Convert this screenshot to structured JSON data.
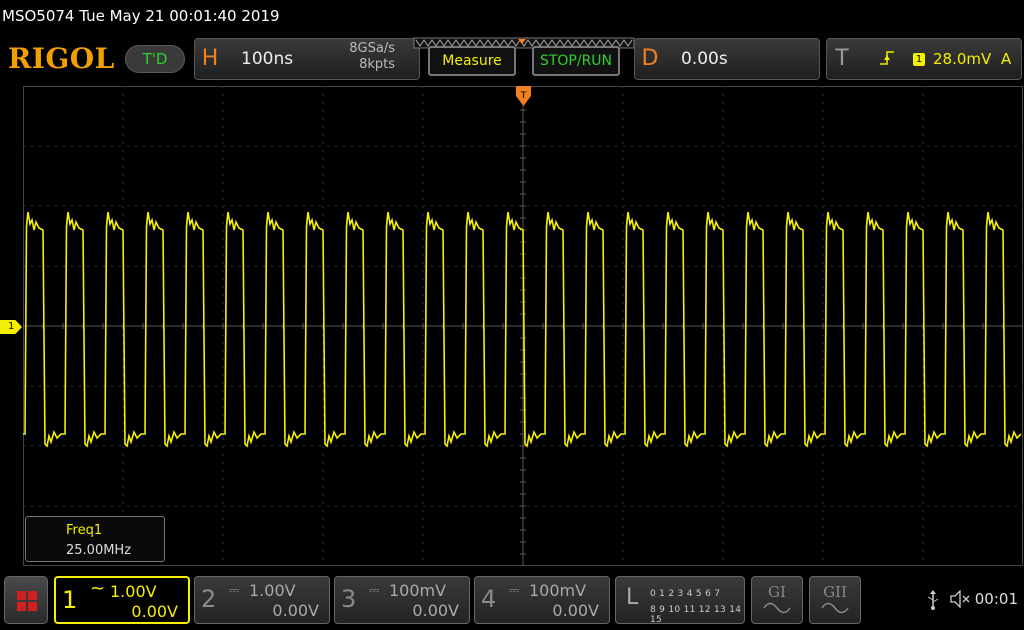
{
  "title": "MSO5074  Tue May 21 00:01:40 2019",
  "logo": "RIGOL",
  "trigger_status_badge": "T'D",
  "horizontal": {
    "letter": "H",
    "timebase": "100ns",
    "sample_rate": "8GSa/s",
    "memory_depth": "8kpts"
  },
  "buttons": {
    "measure": "Measure",
    "stop_run": "STOP/RUN"
  },
  "delay": {
    "letter": "D",
    "value": "0.00s"
  },
  "trigger": {
    "letter": "T",
    "channel": "1",
    "level": "28.0mV",
    "mode": "A"
  },
  "channel1_marker": "1",
  "measurement": {
    "label": "Freq1",
    "value": "25.00MHz"
  },
  "channels": [
    {
      "num": "1",
      "coupling": "~",
      "scale": "1.00V",
      "offset": "0.00V",
      "active": true
    },
    {
      "num": "2",
      "coupling": "⎓",
      "scale": "1.00V",
      "offset": "0.00V",
      "active": false
    },
    {
      "num": "3",
      "coupling": "⎓",
      "scale": "100mV",
      "offset": "0.00V",
      "active": false
    },
    {
      "num": "4",
      "coupling": "⎓",
      "scale": "100mV",
      "offset": "0.00V",
      "active": false
    }
  ],
  "logic": {
    "letter": "L",
    "row1": "0 1 2 3   4 5 6 7",
    "row2": "8 9 10 11 12 13 14 15"
  },
  "generators": [
    {
      "label": "GI"
    },
    {
      "label": "GII"
    }
  ],
  "status_time": "00:01",
  "colors": {
    "ch1": "#f5ef00",
    "logo": "#f0a000",
    "orange": "#f08020",
    "green": "#2fd02f"
  }
}
